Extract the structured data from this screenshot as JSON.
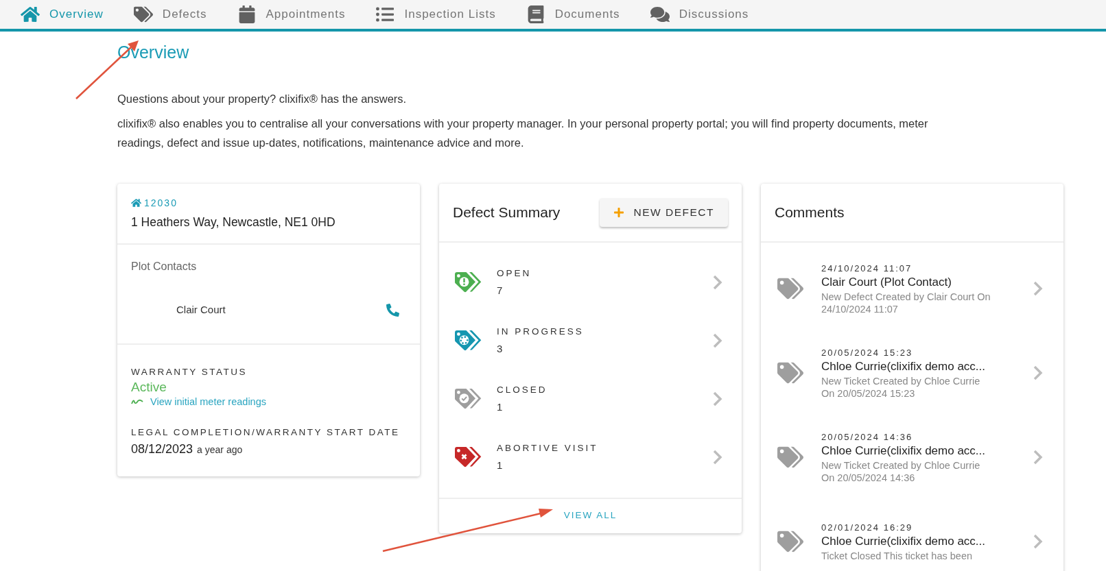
{
  "nav": {
    "tabs": [
      {
        "kind": "home",
        "label": "Overview",
        "selected": true
      },
      {
        "kind": "tags",
        "label": "Defects",
        "selected": false
      },
      {
        "kind": "calendar",
        "label": "Appointments",
        "selected": false
      },
      {
        "kind": "list",
        "label": "Inspection Lists",
        "selected": false
      },
      {
        "kind": "book",
        "label": "Documents",
        "selected": false
      },
      {
        "kind": "comments",
        "label": "Discussions",
        "selected": false
      }
    ]
  },
  "page_title": "Overview",
  "intro": [
    "Questions about your property? clixifix® has the answers.",
    "clixifix® also enables you to centralise all your conversations with your property manager. In your personal property portal; you will find property documents, meter readings, defect and issue up-dates, notifications, maintenance advice and more."
  ],
  "property_card": {
    "plot_id": "12030",
    "address": "1 Heathers Way, Newcastle, NE1 0HD",
    "contacts_label": "Plot Contacts",
    "contacts": [
      {
        "name": "Clair Court"
      }
    ],
    "warranty_label": "WARRANTY STATUS",
    "warranty_status": "Active",
    "meter_link": "View initial meter readings",
    "completion_label": "LEGAL COMPLETION/WARRANTY START DATE",
    "completion_date": "08/12/2023",
    "completion_ago": "a year ago"
  },
  "defect_summary": {
    "title": "Defect Summary",
    "new_button": "NEW DEFECT",
    "rows": [
      {
        "kind": "open",
        "label": "OPEN",
        "count": "7",
        "color": "#4caf50"
      },
      {
        "kind": "in_progress",
        "label": "IN PROGRESS",
        "count": "3",
        "color": "#1596b0"
      },
      {
        "kind": "closed",
        "label": "CLOSED",
        "count": "1",
        "color": "#9e9e9e"
      },
      {
        "kind": "abortive",
        "label": "ABORTIVE VISIT",
        "count": "1",
        "color": "#c62828"
      }
    ],
    "view_all": "VIEW ALL"
  },
  "comments": {
    "title": "Comments",
    "items": [
      {
        "time": "24/10/2024 11:07",
        "author": "Clair Court (Plot Contact)",
        "text": "New Defect Created by Clair Court On 24/10/2024 11:07"
      },
      {
        "time": "20/05/2024 15:23",
        "author": "Chloe Currie(clixifix demo acc...",
        "text": "New Ticket Created by Chloe Currie On 20/05/2024 15:23"
      },
      {
        "time": "20/05/2024 14:36",
        "author": "Chloe Currie(clixifix demo acc...",
        "text": "New Ticket Created by Chloe Currie On 20/05/2024 14:36"
      },
      {
        "time": "02/01/2024 16:29",
        "author": "Chloe Currie(clixifix demo acc...",
        "text": "Ticket Closed This ticket has been"
      }
    ]
  }
}
